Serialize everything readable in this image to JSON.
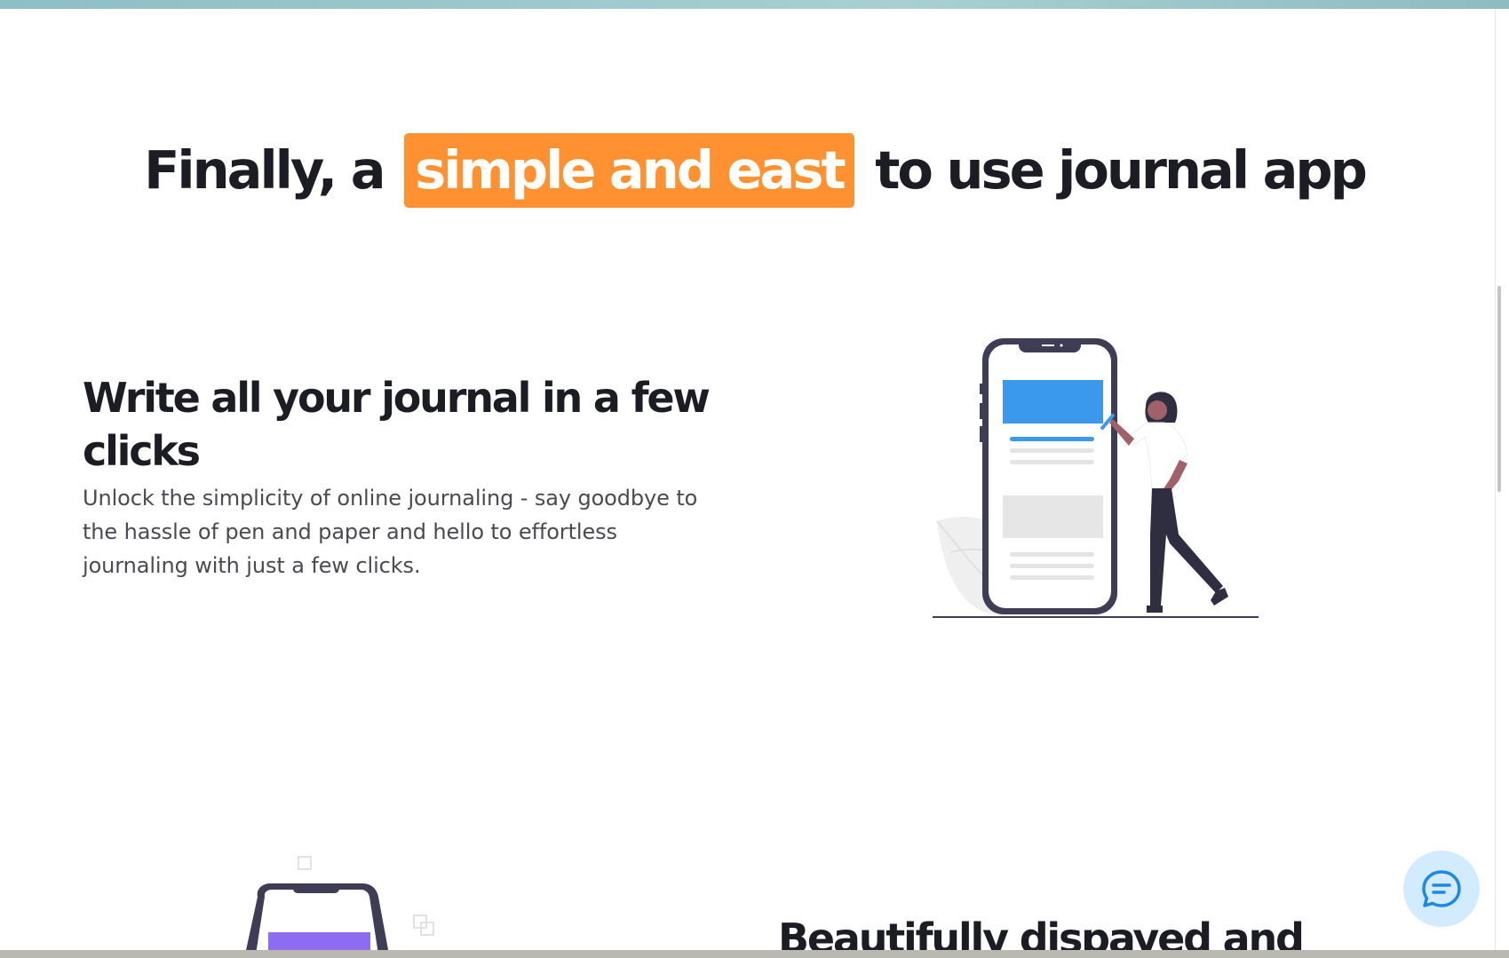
{
  "headline": {
    "prefix": "Finally, a",
    "highlight": "simple and east",
    "suffix": "to use journal app"
  },
  "feature_1": {
    "title": "Write all your journal in a few clicks",
    "description": "Unlock the simplicity of online journaling - say goodbye to the hassle of pen and paper and hello to effortless journaling with just a few clicks."
  },
  "feature_2": {
    "title_partial": "Beautifully dispayed and"
  },
  "icons": [
    "phone-illustration",
    "chat-icon"
  ],
  "colors": {
    "accent": "#ff9130",
    "heading": "#1c1c24",
    "body_text": "#4a4a52",
    "chat_bg": "#d2ebff",
    "phone_card_blue": "#3a99ec",
    "phone_card_purple": "#8c6cf0"
  }
}
